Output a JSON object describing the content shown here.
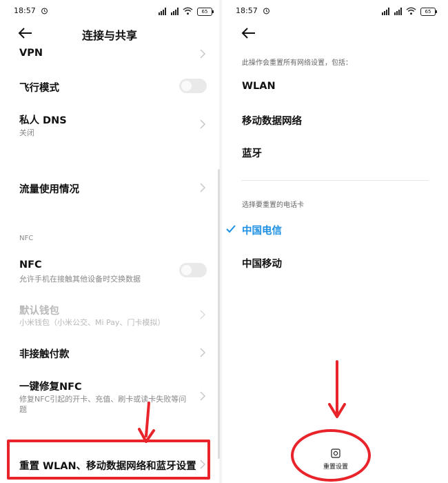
{
  "left": {
    "status": {
      "time": "18:57",
      "battery": "65"
    },
    "title": "连接与共享",
    "items": [
      {
        "label": "VPN"
      },
      {
        "label": "飞行模式",
        "toggle": false
      },
      {
        "label": "私人 DNS",
        "sub": "关闭"
      },
      {
        "label": "流量使用情况"
      },
      {
        "label": "NFC",
        "sub": "允许手机在接触其他设备时交换数据",
        "toggle": false
      },
      {
        "label": "默认钱包",
        "sub": "小米钱包（小米公交、Mi Pay、门卡模拟）",
        "disabled": true
      },
      {
        "label": "非接触付款"
      },
      {
        "label": "一键修复NFC",
        "sub": "修复NFC引起的开卡、充值、刷卡或读卡失败等问",
        "sub2": "题"
      },
      {
        "label": "重置 WLAN、移动数据网络和蓝牙设置"
      }
    ],
    "section_nfc": "NFC"
  },
  "right": {
    "status": {
      "time": "18:57",
      "battery": "65"
    },
    "note": "此操作会重置所有网络设置，包括：",
    "network_items": [
      "WLAN",
      "移动数据网络",
      "蓝牙"
    ],
    "sim_note": "选择要重置的电话卡",
    "sims": [
      {
        "label": "中国电信",
        "selected": true
      },
      {
        "label": "中国移动",
        "selected": false
      }
    ],
    "reset_label": "重置设置"
  },
  "colors": {
    "accent": "#1a8fe3",
    "annotation": "#e8232a"
  }
}
